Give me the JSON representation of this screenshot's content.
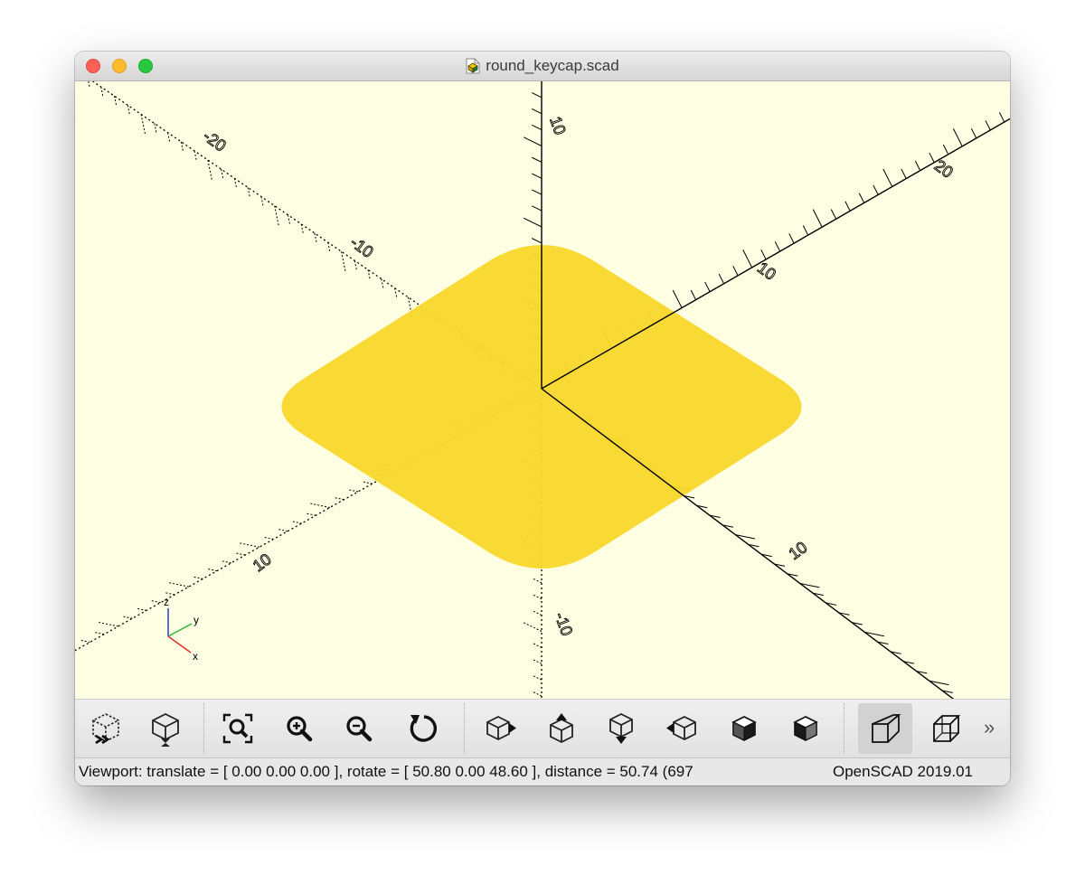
{
  "window": {
    "title": "round_keycap.scad",
    "file_icon": "scad-file-icon",
    "viewport_background": "#fefee2",
    "shape_color": "#f9d72c",
    "axis_color": "#000000",
    "gizmo_colors": {
      "x": "#e03030",
      "y": "#2fb52f",
      "z": "#2e3ccf"
    }
  },
  "viewport": {
    "axis_labels": {
      "neg_x": "-20",
      "x_mid": "-10",
      "x_pos": "10",
      "y_pos": "20",
      "y_pos_near": "10",
      "y_neg": "10",
      "z_pos": "10",
      "z_neg": "-10"
    },
    "gizmo_labels": {
      "x": "x",
      "y": "y",
      "z": "z"
    }
  },
  "toolbar": {
    "buttons": [
      {
        "name": "preview-button",
        "icon": "preview-icon"
      },
      {
        "name": "render-button",
        "icon": "render-icon"
      },
      {
        "name": "view-all-button",
        "icon": "view-all-icon"
      },
      {
        "name": "zoom-in-button",
        "icon": "zoom-in-icon"
      },
      {
        "name": "zoom-out-button",
        "icon": "zoom-out-icon"
      },
      {
        "name": "reset-view-button",
        "icon": "reset-view-icon"
      },
      {
        "name": "view-right-button",
        "icon": "view-right-icon"
      },
      {
        "name": "view-top-button",
        "icon": "view-top-icon"
      },
      {
        "name": "view-bottom-button",
        "icon": "view-bottom-icon"
      },
      {
        "name": "view-left-button",
        "icon": "view-left-icon"
      },
      {
        "name": "view-front-button",
        "icon": "view-front-icon"
      },
      {
        "name": "view-back-button",
        "icon": "view-back-icon"
      },
      {
        "name": "perspective-button",
        "icon": "perspective-icon",
        "active": true
      },
      {
        "name": "orthogonal-button",
        "icon": "orthogonal-icon"
      }
    ],
    "more": "»"
  },
  "status": {
    "viewport_text": "Viewport: translate = [ 0.00 0.00 0.00 ], rotate = [ 50.80 0.00 48.60 ], distance = 50.74 (697",
    "version_text": "OpenSCAD 2019.01"
  }
}
